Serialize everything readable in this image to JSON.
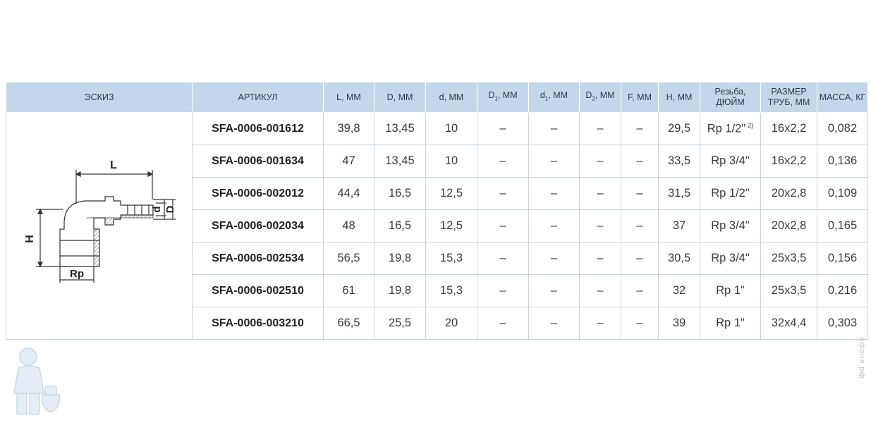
{
  "headers": {
    "sketch": "ЭСКИЗ",
    "article": "АРТИКУЛ",
    "L": "L, ММ",
    "D": "D, ММ",
    "d": "d, ММ",
    "D1_main": "D",
    "D1_sub": "1",
    "D1_unit": ", ММ",
    "d1_main": "d",
    "d1_sub": "1",
    "d1_unit": ", ММ",
    "D2_main": "D",
    "D2_sub": "2",
    "D2_unit": ", ММ",
    "F": "F, ММ",
    "H": "H, ММ",
    "thread_line1": "Резьба,",
    "thread_line2": "ДЮЙМ",
    "pipe_line1": "РАЗМЕР",
    "pipe_line2": "ТРУБ, ММ",
    "mass": "МАССА, КГ"
  },
  "rows": [
    {
      "article": "SFA-0006-001612",
      "L": "39,8",
      "D": "13,45",
      "d": "10",
      "D1": "–",
      "d1": "–",
      "D2": "–",
      "F": "–",
      "H": "29,5",
      "thread": "Rp 1/2\"",
      "thread_note": "2)",
      "pipe": "16x2,2",
      "mass": "0,082"
    },
    {
      "article": "SFA-0006-001634",
      "L": "47",
      "D": "13,45",
      "d": "10",
      "D1": "–",
      "d1": "–",
      "D2": "–",
      "F": "–",
      "H": "33,5",
      "thread": "Rp 3/4\"",
      "thread_note": "",
      "pipe": "16x2,2",
      "mass": "0,136"
    },
    {
      "article": "SFA-0006-002012",
      "L": "44,4",
      "D": "16,5",
      "d": "12,5",
      "D1": "–",
      "d1": "–",
      "D2": "–",
      "F": "–",
      "H": "31,5",
      "thread": "Rp 1/2\"",
      "thread_note": "",
      "pipe": "20x2,8",
      "mass": "0,109"
    },
    {
      "article": "SFA-0006-002034",
      "L": "48",
      "D": "16,5",
      "d": "12,5",
      "D1": "–",
      "d1": "–",
      "D2": "–",
      "F": "–",
      "H": "37",
      "thread": "Rp 3/4\"",
      "thread_note": "",
      "pipe": "20x2,8",
      "mass": "0,165"
    },
    {
      "article": "SFA-0006-002534",
      "L": "56,5",
      "D": "19,8",
      "d": "15,3",
      "D1": "–",
      "d1": "–",
      "D2": "–",
      "F": "–",
      "H": "30,5",
      "thread": "Rp 3/4\"",
      "thread_note": "",
      "pipe": "25x3,5",
      "mass": "0,156"
    },
    {
      "article": "SFA-0006-002510",
      "L": "61",
      "D": "19,8",
      "d": "15,3",
      "D1": "–",
      "d1": "–",
      "D2": "–",
      "F": "–",
      "H": "32",
      "thread": "Rp 1\"",
      "thread_note": "",
      "pipe": "25x3,5",
      "mass": "0,216"
    },
    {
      "article": "SFA-0006-003210",
      "L": "66,5",
      "D": "25,5",
      "d": "20",
      "D1": "–",
      "d1": "–",
      "D2": "–",
      "F": "–",
      "H": "39",
      "thread": "Rp 1\"",
      "thread_note": "",
      "pipe": "32x4,4",
      "mass": "0,303"
    }
  ],
  "sketch_labels": {
    "L": "L",
    "H": "H",
    "d": "d",
    "D": "D",
    "Rp": "Rp"
  },
  "watermark": "афоня.рф",
  "colors": {
    "header_bg": "#c4d7ea",
    "grid": "#c5d4e3",
    "drawing": "#333333",
    "hatch": "#555555"
  }
}
